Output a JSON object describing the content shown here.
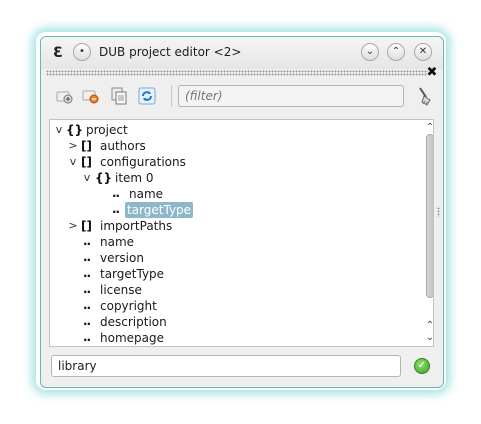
{
  "window": {
    "title": "DUB project editor <2>",
    "app_icon": "dub-icon",
    "buttons": [
      "menu-button",
      "minimize-button",
      "maximize-button",
      "close-button"
    ]
  },
  "toolbar": {
    "filter_placeholder": "(filter)",
    "tools": [
      "add-property-icon",
      "remove-property-icon",
      "copy-icon",
      "refresh-icon",
      "clear-filter-broom-icon"
    ]
  },
  "tree": {
    "rows": [
      {
        "expander": "v",
        "kind": "{}",
        "label": "project",
        "selected": false
      },
      {
        "expander": ">",
        "kind": "[]",
        "label": "authors",
        "selected": false
      },
      {
        "expander": "v",
        "kind": "[]",
        "label": "configurations",
        "selected": false
      },
      {
        "expander": "v",
        "kind": "{}",
        "label": "item 0",
        "selected": false
      },
      {
        "expander": "",
        "kind": "..",
        "label": "name",
        "selected": false
      },
      {
        "expander": "",
        "kind": "..",
        "label": "targetType",
        "selected": true
      },
      {
        "expander": ">",
        "kind": "[]",
        "label": "importPaths",
        "selected": false
      },
      {
        "expander": "",
        "kind": "..",
        "label": "name",
        "selected": false
      },
      {
        "expander": "",
        "kind": "..",
        "label": "version",
        "selected": false
      },
      {
        "expander": "",
        "kind": "..",
        "label": "targetType",
        "selected": false
      },
      {
        "expander": "",
        "kind": "..",
        "label": "license",
        "selected": false
      },
      {
        "expander": "",
        "kind": "..",
        "label": "copyright",
        "selected": false
      },
      {
        "expander": "",
        "kind": "..",
        "label": "description",
        "selected": false
      },
      {
        "expander": "",
        "kind": "..",
        "label": "homepage",
        "selected": false
      }
    ]
  },
  "value_editor": {
    "value": "library",
    "accept_icon": "accept-check-icon"
  },
  "colors": {
    "selection": "#8fb7cc",
    "window_border": "#66b8b8",
    "accept_green": "#3ea12a"
  }
}
